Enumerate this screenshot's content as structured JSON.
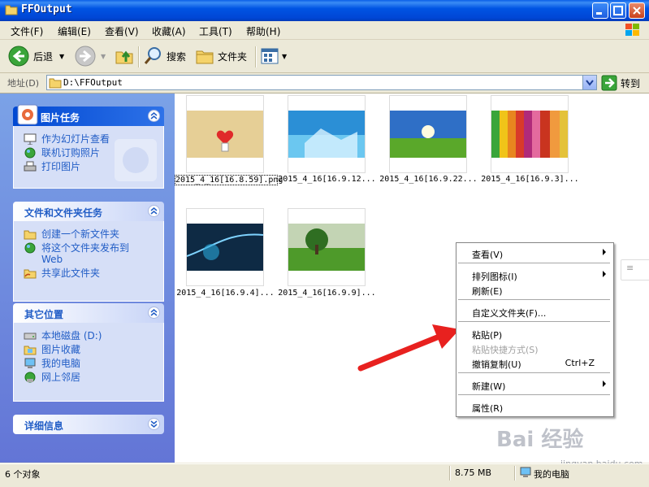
{
  "window": {
    "title": "FFOutput"
  },
  "menu": [
    "文件(F)",
    "编辑(E)",
    "查看(V)",
    "收藏(A)",
    "工具(T)",
    "帮助(H)"
  ],
  "toolbar": {
    "back": "后退",
    "search": "搜索",
    "folders": "文件夹"
  },
  "address": {
    "label": "地址(D)",
    "value": "D:\\FFOutput",
    "go": "转到"
  },
  "panels": {
    "picture_tasks": {
      "title": "图片任务",
      "items": [
        "作为幻灯片查看",
        "联机订购照片",
        "打印图片"
      ]
    },
    "file_tasks": {
      "title": "文件和文件夹任务",
      "items": [
        "创建一个新文件夹",
        "将这个文件夹发布到 Web",
        "共享此文件夹"
      ]
    },
    "other_places": {
      "title": "其它位置",
      "items": [
        "本地磁盘 (D:)",
        "图片收藏",
        "我的电脑",
        "网上邻居"
      ]
    },
    "details": {
      "title": "详细信息"
    }
  },
  "thumbnails": [
    "2015_4_16[16.8.59].png",
    "2015_4_16[16.9.12...",
    "2015_4_16[16.9.22...",
    "2015_4_16[16.9.3]...",
    "2015_4_16[16.9.4]...",
    "2015_4_16[16.9.9]..."
  ],
  "context_menu": {
    "view": "查看(V)",
    "arrange": "排列图标(I)",
    "refresh": "刷新(E)",
    "customize": "自定义文件夹(F)...",
    "paste": "粘贴(P)",
    "paste_shortcut": "粘贴快捷方式(S)",
    "undo_copy": "撤销复制(U)",
    "undo_shortcut": "Ctrl+Z",
    "new": "新建(W)",
    "properties": "属性(R)"
  },
  "status": {
    "objects": "6 个对象",
    "size": "8.75 MB",
    "location": "我的电脑"
  },
  "watermark": "Bai 经验",
  "watermark_url": "jingyan.baidu.com",
  "colors": {
    "titlebar": "#0054e3",
    "task_link": "#215dc6",
    "arrow": "#e8211f"
  }
}
